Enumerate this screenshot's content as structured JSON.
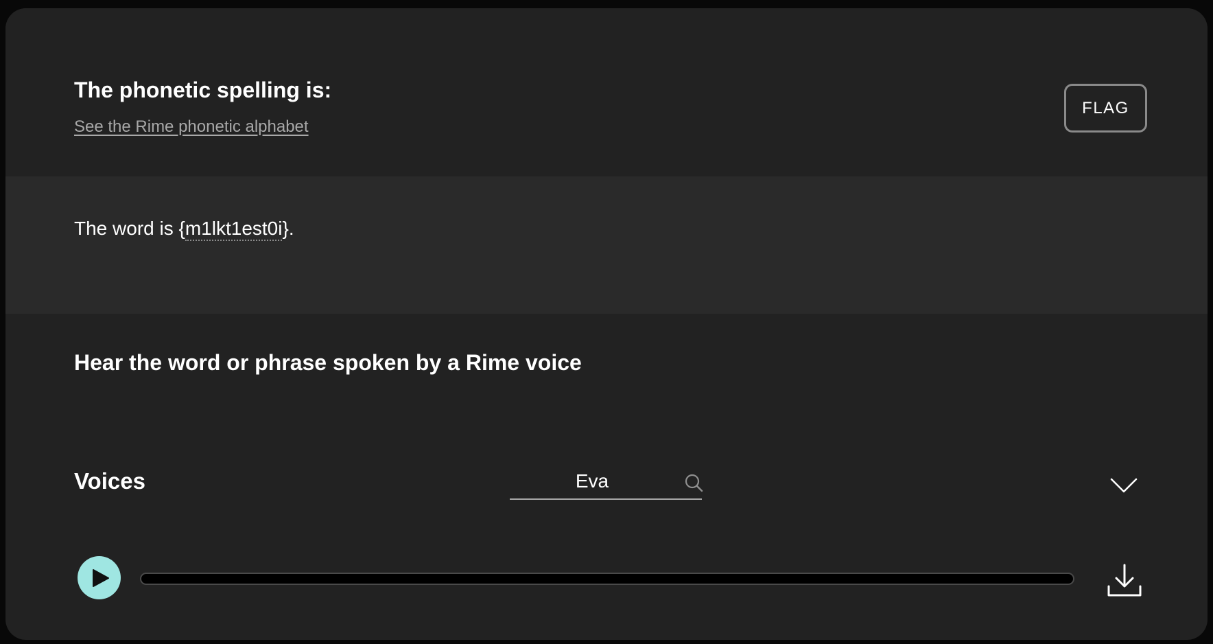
{
  "header": {
    "title": "The phonetic spelling is:",
    "alphabet_link": "See the Rime phonetic alphabet",
    "flag_label": "FLAG"
  },
  "word": {
    "prefix": "The word is {",
    "phonetic": "m1lkt1est0i",
    "suffix": "}."
  },
  "hear": {
    "title": "Hear the word or phrase spoken by a Rime voice"
  },
  "voices": {
    "label": "Voices",
    "search_value": "Eva",
    "search_icon": "search-icon",
    "dropdown_icon": "chevron-down-icon"
  },
  "player": {
    "play_icon": "play-icon",
    "progress": 0,
    "download_icon": "download-icon",
    "accent_color": "#9fe6e2"
  }
}
